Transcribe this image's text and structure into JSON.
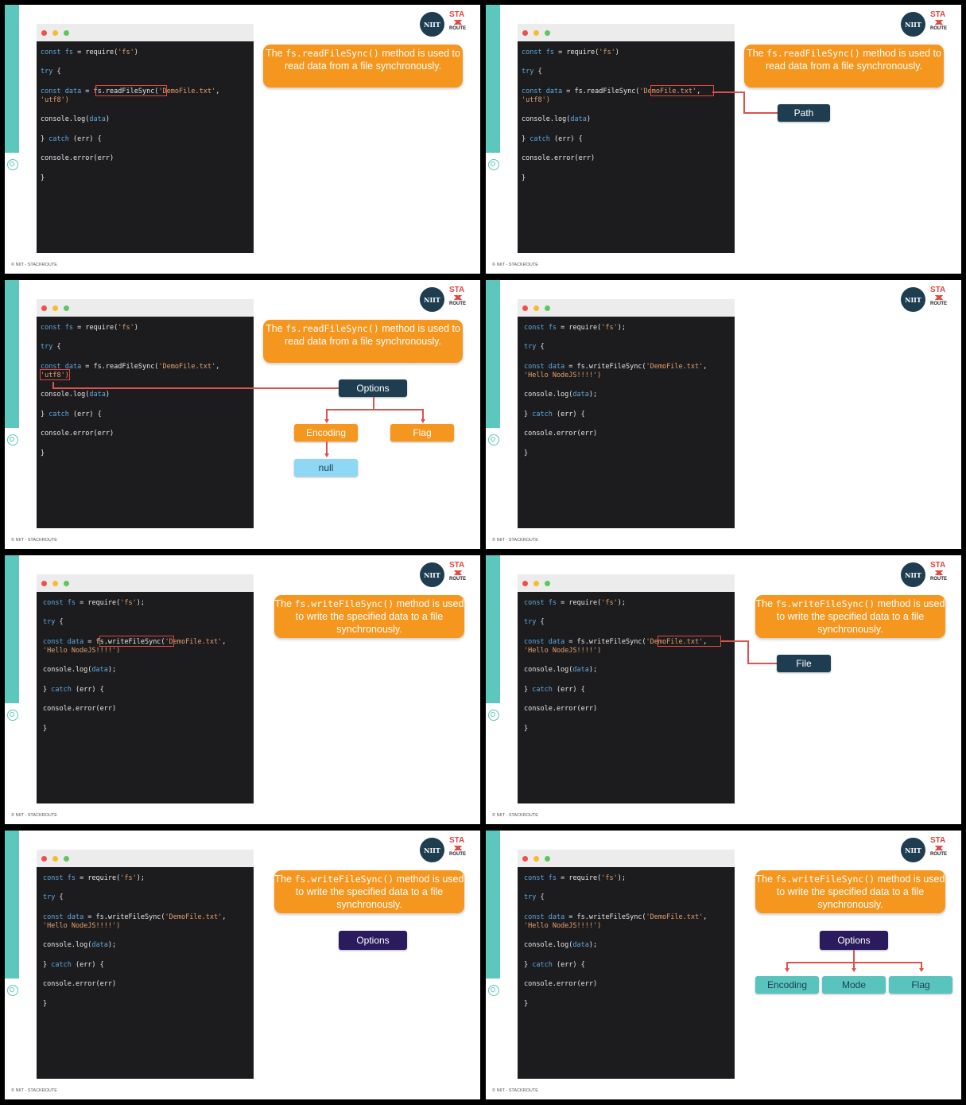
{
  "common": {
    "footer": "© NIIT - STACKROUTE",
    "logo_niit": "NIIT",
    "logo_sta": "STA",
    "logo_route": "ROUTE",
    "colors": {
      "accent_teal": "#5cc7bd",
      "orange": "#f5961e",
      "navy": "#1e3d50",
      "code_bg": "#1c1c1e",
      "highlight_red": "#e0463f"
    }
  },
  "read_code": {
    "l1a": "const",
    "l1b": "fs",
    "l1c": " = require(",
    "l1d": "'fs'",
    "l1e": ")",
    "l2a": "try",
    "l2b": " {",
    "l3a": "const",
    "l3b": " data",
    "l3c": " = ",
    "l3d": "fs.readFileSync(",
    "l3e": "'DemoFile.txt'",
    "l3f": ",",
    "l4": "'utf8')",
    "l5a": "console.log(",
    "l5b": "data",
    "l5c": ")",
    "l6a": "} ",
    "l6b": "catch",
    "l6c": " (err) {",
    "l7": "console.error(err)",
    "l8": "}"
  },
  "write_code": {
    "l1a": "const",
    "l1b": "fs",
    "l1c": " = require(",
    "l1d": "'fs'",
    "l1e": ");",
    "l2a": "try",
    "l2b": " {",
    "l3a": "const",
    "l3b": " data",
    "l3c": " = ",
    "l3d": "fs.writeFileSync(",
    "l3e": "'DemoFile.txt'",
    "l3f": ",",
    "l4": "'Hello NodeJS!!!!')",
    "l5a": "console.log(",
    "l5b": "data",
    "l5c": ");",
    "l6a": "} ",
    "l6b": "catch",
    "l6c": " (err) {",
    "l7": "console.error(err)",
    "l8": "}"
  },
  "read_info": {
    "pre": "The ",
    "mono": "fs.readFileSync()",
    "post": " method is used to read data from a file synchronously."
  },
  "write_info": {
    "pre": "The ",
    "mono": "fs.writeFileSync()",
    "post": " method is used to write the specified data to a file synchronously."
  },
  "labels": {
    "path": "Path",
    "options": "Options",
    "encoding": "Encoding",
    "flag": "Flag",
    "null": "null",
    "file": "File",
    "mode": "Mode"
  }
}
